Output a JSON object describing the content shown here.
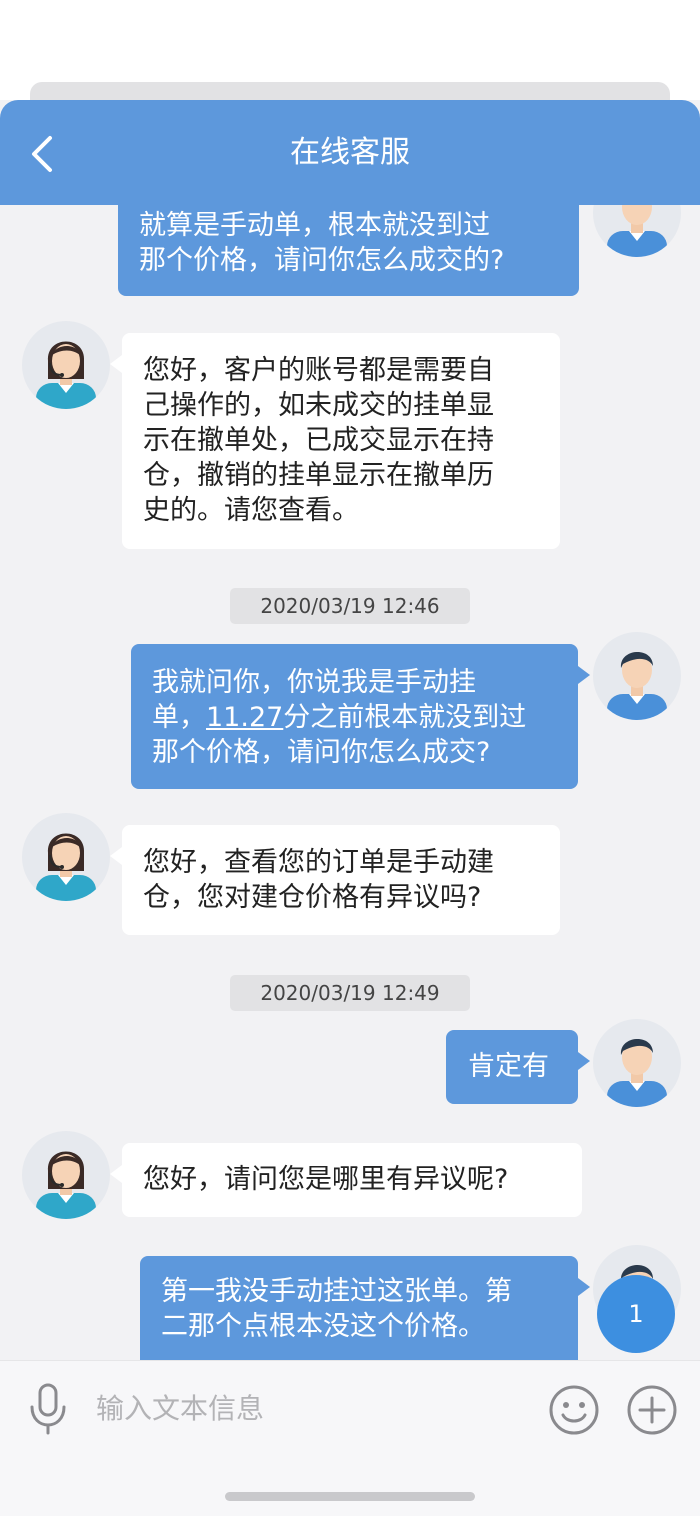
{
  "header": {
    "title": "在线客服",
    "back_icon": "chevron-left-icon"
  },
  "colors": {
    "accent": "#5d98dc",
    "agent_bubble": "#ffffff",
    "background": "#f2f2f4",
    "badge": "#3d8fe0"
  },
  "messages": [
    {
      "sender": "user",
      "lines": [
        "就算是手动单，根本就没到过",
        "那个价格，请问你怎么成交的?"
      ]
    },
    {
      "sender": "agent",
      "lines": [
        "您好，客户的账号都是需要自",
        "己操作的，如未成交的挂单显",
        "示在撤单处，已成交显示在持",
        "仓，撤销的挂单显示在撤单历",
        "史的。请您查看。"
      ]
    },
    {
      "sender": "timestamp",
      "text": "2020/03/19 12:46"
    },
    {
      "sender": "user",
      "line1": "我就问你，你说我是手动挂",
      "line2_a": "单，",
      "line2_link": "11.27",
      "line2_b": "分之前根本就没到过",
      "line3": "那个价格，请问你怎么成交?"
    },
    {
      "sender": "agent",
      "lines": [
        "您好，查看您的订单是手动建",
        "仓，您对建仓价格有异议吗?"
      ]
    },
    {
      "sender": "timestamp",
      "text": "2020/03/19 12:49"
    },
    {
      "sender": "user",
      "lines": [
        "肯定有"
      ]
    },
    {
      "sender": "agent",
      "lines": [
        "您好，请问您是哪里有异议呢?"
      ]
    },
    {
      "sender": "user",
      "lines": [
        "第一我没手动挂过这张单。第",
        "二那个点根本没这个价格。"
      ]
    }
  ],
  "unread_badge": "1",
  "input": {
    "placeholder": "输入文本信息",
    "mic_icon": "microphone-icon",
    "emoji_icon": "smiley-icon",
    "plus_icon": "plus-circle-icon"
  }
}
